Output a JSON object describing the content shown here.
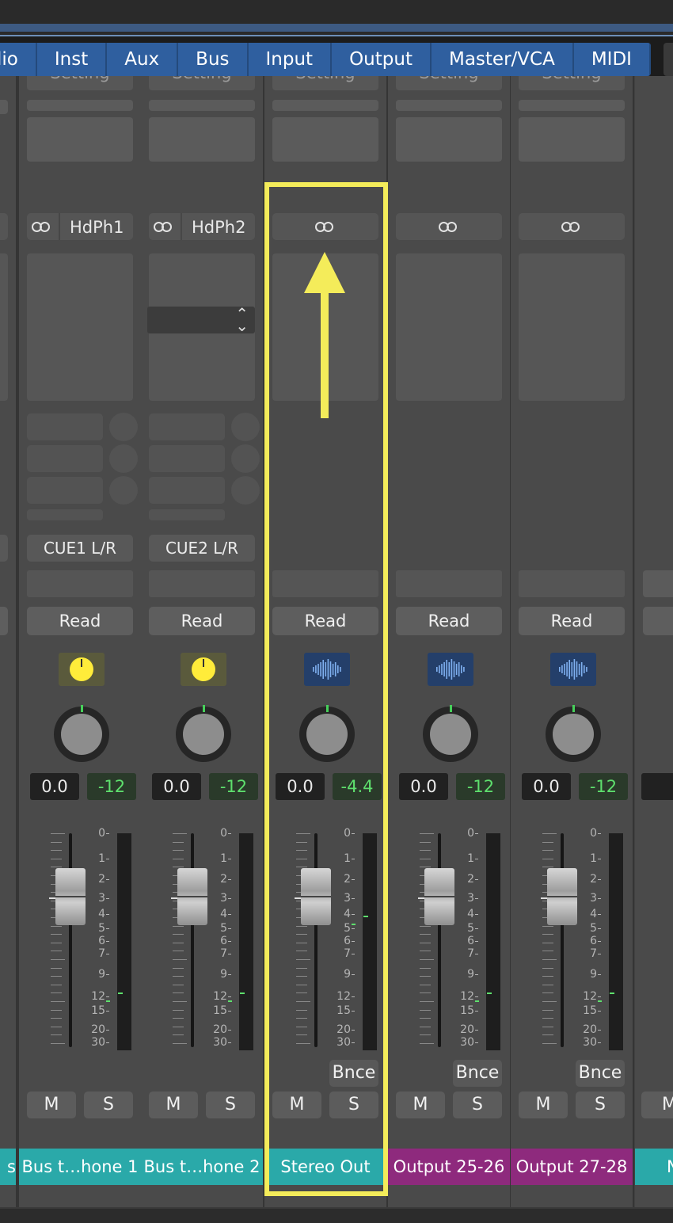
{
  "tabs": [
    "lio",
    "Inst",
    "Aux",
    "Bus",
    "Input",
    "Output",
    "Master/VCA",
    "MIDI"
  ],
  "colors": {
    "tab_bg": "#2f5f9f",
    "strip_bg": "#4a4a4a",
    "bus_name": "#2aa9a9",
    "output_name": "#8e2a7d",
    "highlight": "#f4ec5a",
    "meter_peak": "#5ee06d"
  },
  "meter_scale": [
    "0",
    "1",
    "2",
    "3",
    "4",
    "5",
    "6",
    "7",
    "9",
    "12",
    "15",
    "20",
    "30"
  ],
  "channel_strips": [
    {
      "name": "Bus t…hone 1",
      "name_color": "#2aa9a9",
      "link_label": "HdPh1",
      "output": "CUE1 L/R",
      "automation": "Read",
      "type_icon": "yellow-knob-icon",
      "volume": "0.0",
      "peak": "-12",
      "mute": "M",
      "solo": "S",
      "bounce": "",
      "fader_level_db": "0.0",
      "meter_peak_db": -12,
      "has_selector": false
    },
    {
      "name": "Bus t…hone 2",
      "name_color": "#2aa9a9",
      "link_label": "HdPh2",
      "output": "CUE2 L/R",
      "automation": "Read",
      "type_icon": "yellow-knob-icon",
      "volume": "0.0",
      "peak": "-12",
      "mute": "M",
      "solo": "S",
      "bounce": "",
      "fader_level_db": "0.0",
      "meter_peak_db": -12,
      "has_selector": true
    },
    {
      "name": "Stereo Out",
      "name_color": "#2aa9a9",
      "link_label": "",
      "output": "",
      "automation": "Read",
      "type_icon": "waveform-icon",
      "volume": "0.0",
      "peak": "-4.4",
      "mute": "M",
      "solo": "S",
      "bounce": "Bnce",
      "fader_level_db": "0.0",
      "meter_peak_db": -4.4,
      "has_selector": false
    },
    {
      "name": "Output 25-26",
      "name_color": "#8e2a7d",
      "link_label": "",
      "output": "",
      "automation": "Read",
      "type_icon": "waveform-icon",
      "volume": "0.0",
      "peak": "-12",
      "mute": "M",
      "solo": "S",
      "bounce": "Bnce",
      "fader_level_db": "0.0",
      "meter_peak_db": -12,
      "has_selector": false
    },
    {
      "name": "Output 27-28",
      "name_color": "#8e2a7d",
      "link_label": "",
      "output": "",
      "automation": "Read",
      "type_icon": "waveform-icon",
      "volume": "0.0",
      "peak": "-12",
      "mute": "M",
      "solo": "S",
      "bounce": "Bnce",
      "fader_level_db": "0.0",
      "meter_peak_db": -12,
      "has_selector": false
    }
  ],
  "partial_right": {
    "mute": "M",
    "name": "N"
  },
  "partial_left": {
    "name": "s"
  },
  "setting_label": "Setting"
}
